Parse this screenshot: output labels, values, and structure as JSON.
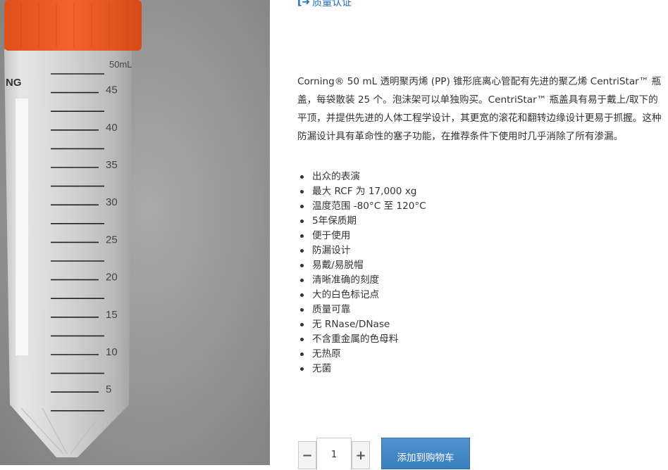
{
  "product_image": {
    "alt": "Corning 50 mL centrifuge tube",
    "tube_brand_fragment": "NG",
    "capacity_mark": "50mL",
    "graduations": [
      "45",
      "40",
      "35",
      "30",
      "25",
      "20",
      "15",
      "10",
      "5"
    ],
    "cap_color": "#f15a22"
  },
  "certification": {
    "icon": "external-link-icon",
    "label": "质量认证"
  },
  "description": "Corning® 50 mL 透明聚丙烯 (PP) 锥形底离心管配有先进的聚乙烯 CentriStar™ 瓶盖，每袋散装 25 个。泡沫架可以单独购买。CentriStar™ 瓶盖具有易于戴上/取下的平顶，并提供先进的人体工程学设计，其更宽的滚花和翻转边缘设计更易于抓握。这种防漏设计具有革命性的塞子功能，在推荐条件下使用时几乎消除了所有渗漏。",
  "features": [
    "出众的表演",
    "最大 RCF 为 17,000 xg",
    "温度范围 -80°C 至 120°C",
    "5年保质期",
    "便于使用",
    "防漏设计",
    "易戴/易脱帽",
    "清晰准确的刻度",
    "大的白色标记点",
    "质量可靠",
    "无 RNase/DNase",
    "不含重金属的色母料",
    "无热原",
    "无菌"
  ],
  "quantity": {
    "decrement_label": "−",
    "value": "1",
    "increment_label": "+"
  },
  "cart": {
    "label": "添加到购物车",
    "accent": "#3a7fbd"
  }
}
